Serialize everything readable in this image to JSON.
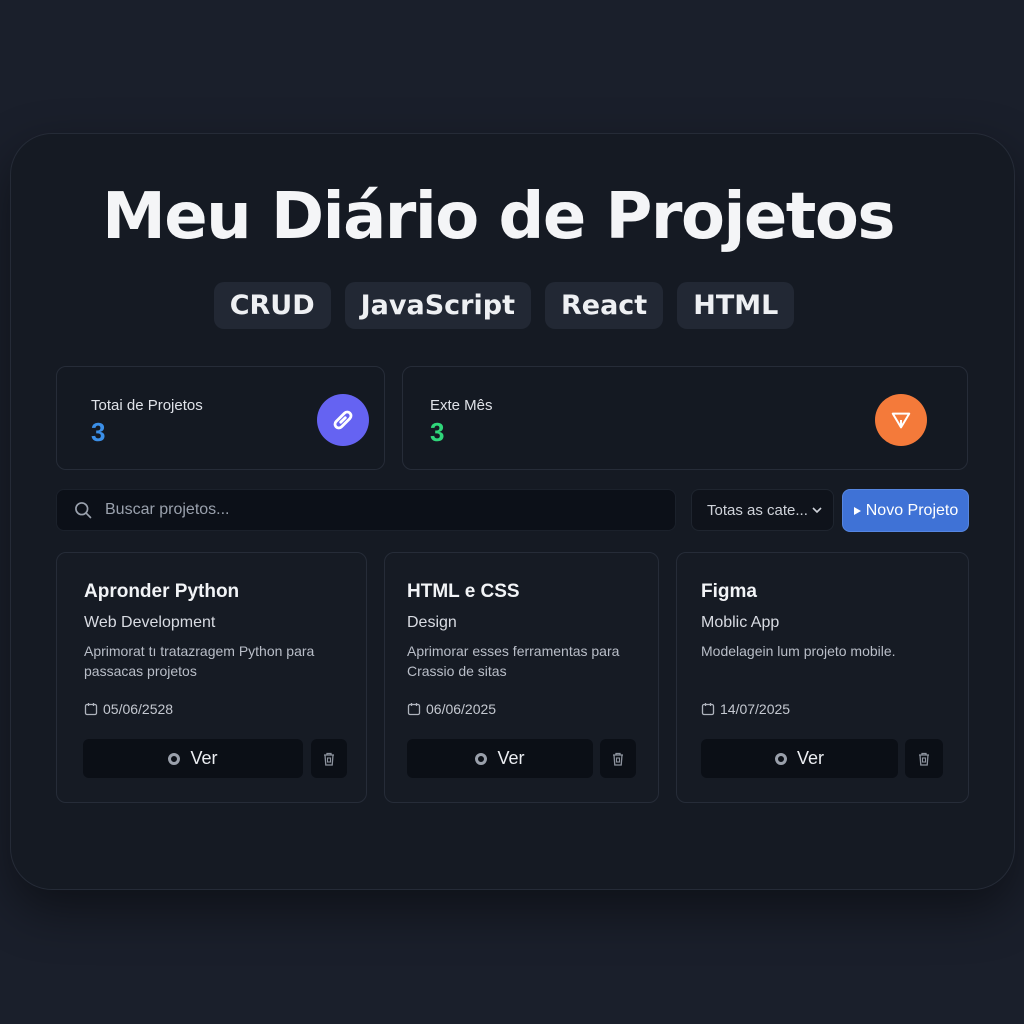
{
  "page_title": "Meu Diário de Projetos",
  "tags": [
    "CRUD",
    "JavaScript",
    "React",
    "HTML"
  ],
  "stats": [
    {
      "label": "Totai de Projetos",
      "value": "3",
      "value_color": "#3b8fe8",
      "icon": "paperclip-icon",
      "icon_bg": "#6563f2"
    },
    {
      "label": "Exte Mês",
      "value": "3",
      "value_color": "#2fd67a",
      "icon": "send-icon",
      "icon_bg": "#f47a3a"
    }
  ],
  "search": {
    "placeholder": "Buscar projetos...",
    "value": ""
  },
  "category_filter": {
    "selected": "Totas as cate..."
  },
  "new_project_button": {
    "label": "Novo Projeto",
    "color": "#3f72d6"
  },
  "projects": [
    {
      "title": "Apronder Python",
      "category": "Web Development",
      "description": "Aprimorat tı tratazragem Python para passacas projetos",
      "date": "05/06/2528",
      "view_label": "Ver"
    },
    {
      "title": "HTML e CSS",
      "category": "Design",
      "description": "Aprimorar esses ferramentas para Crassio de sitas",
      "date": "06/06/2025",
      "view_label": "Ver"
    },
    {
      "title": "Figma",
      "category": "Moblic App",
      "description": "Modelagein lum projeto mobile.",
      "date": "14/07/2025",
      "view_label": "Ver"
    }
  ]
}
